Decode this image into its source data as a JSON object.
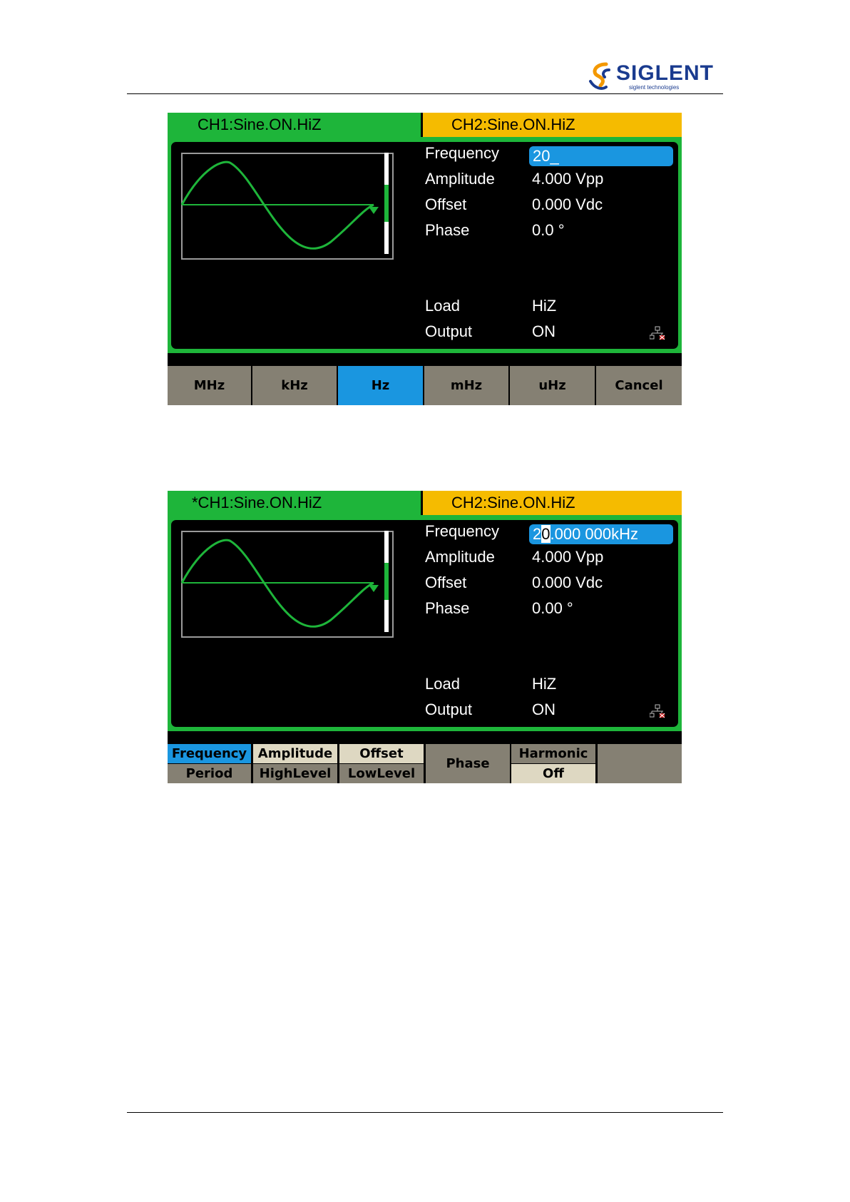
{
  "header": {
    "brand": "SIGLENT",
    "tagline": "siglent technologies",
    "colors": {
      "brand_blue": "#1a3b8f",
      "brand_orange": "#f39800"
    }
  },
  "colors": {
    "ch1_green": "#1eb53a",
    "ch2_yellow": "#f5bb00",
    "highlight_blue": "#1a96e0",
    "softkey_gray": "#858073",
    "softkey_cream": "#ded8c2"
  },
  "screens": [
    {
      "ch1_tab": "CH1:Sine.ON.HiZ",
      "ch2_tab": "CH2:Sine.ON.HiZ",
      "params": {
        "frequency_label": "Frequency",
        "frequency_value": "20_",
        "amplitude_label": "Amplitude",
        "amplitude_value": "4.000 Vpp",
        "offset_label": "Offset",
        "offset_value": "0.000 Vdc",
        "phase_label": "Phase",
        "phase_value": "0.0 °",
        "load_label": "Load",
        "load_value": "HiZ",
        "output_label": "Output",
        "output_value": "ON"
      },
      "softkeys": [
        "MHz",
        "kHz",
        "Hz",
        "mHz",
        "uHz",
        "Cancel"
      ],
      "selected_softkey": "Hz",
      "icon": "lan-disconnected-icon"
    },
    {
      "ch1_tab": "*CH1:Sine.ON.HiZ",
      "ch2_tab": "CH2:Sine.ON.HiZ",
      "params": {
        "frequency_label": "Frequency",
        "frequency_cursor_prefix": "2",
        "frequency_cursor_digit": "0",
        "frequency_cursor_suffix": ".000 000kHz",
        "amplitude_label": "Amplitude",
        "amplitude_value": "4.000 Vpp",
        "offset_label": "Offset",
        "offset_value": "0.000 Vdc",
        "phase_label": "Phase",
        "phase_value": "0.00 °",
        "load_label": "Load",
        "load_value": "HiZ",
        "output_label": "Output",
        "output_value": "ON"
      },
      "softkeys": {
        "frequency": "Frequency",
        "period": "Period",
        "amplitude": "Amplitude",
        "highlevel": "HighLevel",
        "offset": "Offset",
        "lowlevel": "LowLevel",
        "phase": "Phase",
        "harmonic": "Harmonic",
        "harmonic_state": "Off"
      },
      "icon": "lan-disconnected-icon"
    }
  ]
}
